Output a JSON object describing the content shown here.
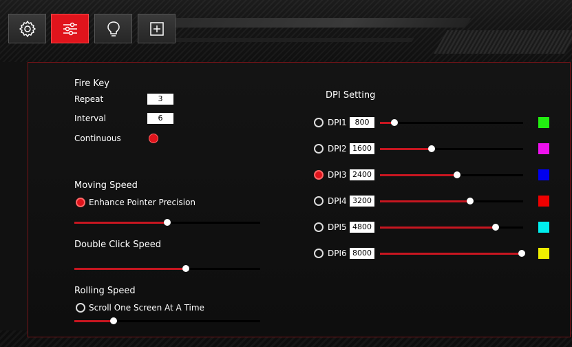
{
  "tabs": [
    {
      "name": "settings",
      "icon": "gear-icon",
      "active": false
    },
    {
      "name": "sliders",
      "icon": "sliders-icon",
      "active": true
    },
    {
      "name": "lighting",
      "icon": "lightbulb-icon",
      "active": false
    },
    {
      "name": "macro",
      "icon": "plus-square-icon",
      "active": false
    }
  ],
  "fire_key": {
    "title": "Fire Key",
    "repeat_label": "Repeat",
    "repeat_value": "3",
    "interval_label": "Interval",
    "interval_value": "6",
    "continuous_label": "Continuous"
  },
  "moving_speed": {
    "title": "Moving Speed",
    "enhance_label": "Enhance Pointer Precision",
    "enhance_on": true,
    "level": 0.5
  },
  "double_click": {
    "title": "Double Click Speed",
    "level": 0.6
  },
  "rolling_speed": {
    "title": "Rolling Speed",
    "scroll_label": "Scroll One Screen At A Time",
    "scroll_on": false,
    "level": 0.21
  },
  "dpi": {
    "title": "DPI Setting",
    "items": [
      {
        "label": "DPI1",
        "value": "800",
        "selected": false,
        "level": 0.1,
        "color": "#22ee11"
      },
      {
        "label": "DPI2",
        "value": "1600",
        "selected": false,
        "level": 0.36,
        "color": "#ee11ee"
      },
      {
        "label": "DPI3",
        "value": "2400",
        "selected": true,
        "level": 0.54,
        "color": "#0000ee"
      },
      {
        "label": "DPI4",
        "value": "3200",
        "selected": false,
        "level": 0.63,
        "color": "#ee0000"
      },
      {
        "label": "DPI5",
        "value": "4800",
        "selected": false,
        "level": 0.81,
        "color": "#00eeee"
      },
      {
        "label": "DPI6",
        "value": "8000",
        "selected": false,
        "level": 1.0,
        "color": "#eeee00"
      }
    ]
  }
}
